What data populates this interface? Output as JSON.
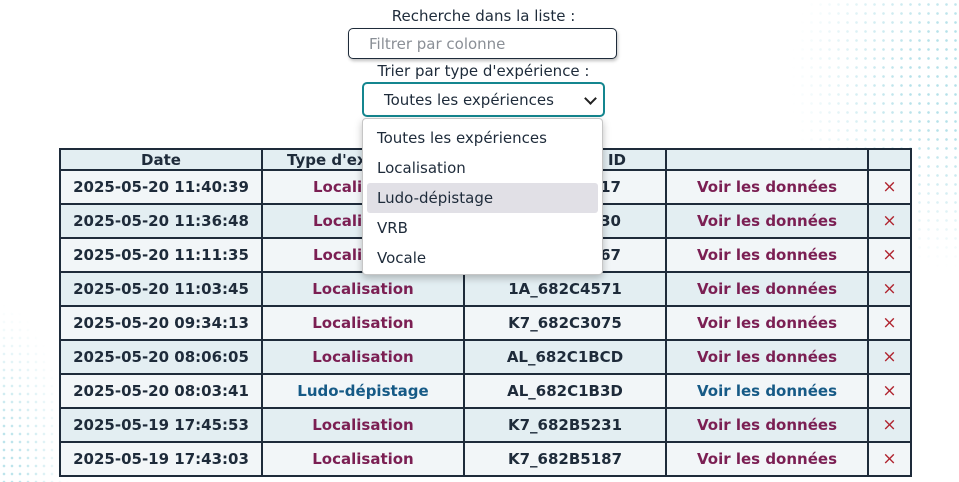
{
  "search": {
    "label": "Recherche dans la liste :",
    "placeholder": "Filtrer par colonne",
    "value": ""
  },
  "sort": {
    "label": "Trier par type d'expérience :",
    "selected": "Toutes les expériences",
    "options": [
      "Toutes les expériences",
      "Localisation",
      "Ludo-dépistage",
      "VRB",
      "Vocale"
    ],
    "highlighted": "Ludo-dépistage"
  },
  "table": {
    "headers": [
      "Date",
      "Type d'ex",
      "ID",
      "",
      ""
    ],
    "rows": [
      {
        "date": "2025-05-20 11:40:39",
        "type": "Locali",
        "id": "17",
        "action": "Voir les données",
        "delete": "×"
      },
      {
        "date": "2025-05-20 11:36:48",
        "type": "Locali",
        "id": "30",
        "action": "Voir les données",
        "delete": "×"
      },
      {
        "date": "2025-05-20 11:11:35",
        "type": "Locali",
        "id": "67",
        "action": "Voir les données",
        "delete": "×"
      },
      {
        "date": "2025-05-20 11:03:45",
        "type": "Localisation",
        "id": "1A_682C4571",
        "action": "Voir les données",
        "delete": "×"
      },
      {
        "date": "2025-05-20 09:34:13",
        "type": "Localisation",
        "id": "K7_682C3075",
        "action": "Voir les données",
        "delete": "×"
      },
      {
        "date": "2025-05-20 08:06:05",
        "type": "Localisation",
        "id": "AL_682C1BCD",
        "action": "Voir les données",
        "delete": "×"
      },
      {
        "date": "2025-05-20 08:03:41",
        "type": "Ludo-dépistage",
        "id": "AL_682C1B3D",
        "action": "Voir les données",
        "delete": "×"
      },
      {
        "date": "2025-05-19 17:45:53",
        "type": "Localisation",
        "id": "K7_682B5231",
        "action": "Voir les données",
        "delete": "×"
      },
      {
        "date": "2025-05-19 17:43:03",
        "type": "Localisation",
        "id": "K7_682B5187",
        "action": "Voir les données",
        "delete": "×"
      }
    ]
  },
  "colors": {
    "accent_teal": "#14868f",
    "localisation_text": "#7b1f53",
    "ludo_text": "#165a86",
    "delete_x": "#b0242f"
  }
}
